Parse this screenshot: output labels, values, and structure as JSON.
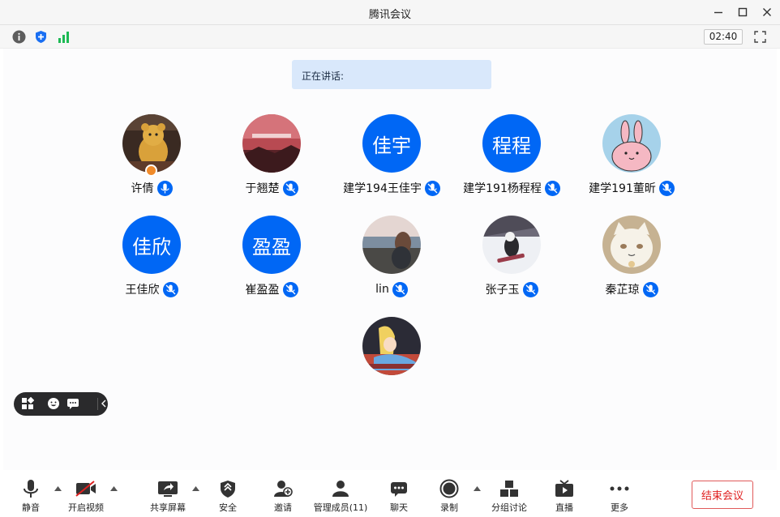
{
  "window": {
    "title": "腾讯会议"
  },
  "meeting": {
    "timer": "02:40",
    "speaking_label": "正在讲话:"
  },
  "participants": [
    {
      "name": "许倩",
      "avatar": "photo-bear",
      "host": true
    },
    {
      "name": "于翘楚",
      "avatar": "photo-banners"
    },
    {
      "name": "建学194王佳宇",
      "avatar_text": "佳宇"
    },
    {
      "name": "建学191杨程程",
      "avatar_text": "程程"
    },
    {
      "name": "建学191董昕",
      "avatar": "photo-rabbit"
    },
    {
      "name": "王佳欣",
      "avatar_text": "佳欣"
    },
    {
      "name": "崔盈盈",
      "avatar_text": "盈盈"
    },
    {
      "name": "lin",
      "avatar": "photo-seaside"
    },
    {
      "name": "张子玉",
      "avatar": "photo-snowboard"
    },
    {
      "name": "秦芷琼",
      "avatar": "photo-cat"
    },
    {
      "name": "",
      "avatar": "photo-alice"
    }
  ],
  "toolbar": {
    "mute": "静音",
    "video": "开启视频",
    "share": "共享屏幕",
    "security": "安全",
    "invite": "邀请",
    "members": "管理成员(11)",
    "chat": "聊天",
    "record": "录制",
    "breakout": "分组讨论",
    "live": "直播",
    "more": "更多",
    "end": "结束会议"
  },
  "colors": {
    "accent": "#0067f5",
    "speaking_bg": "#d9e8fb",
    "end_red": "#e02020",
    "host_badge": "#f08a2a"
  }
}
